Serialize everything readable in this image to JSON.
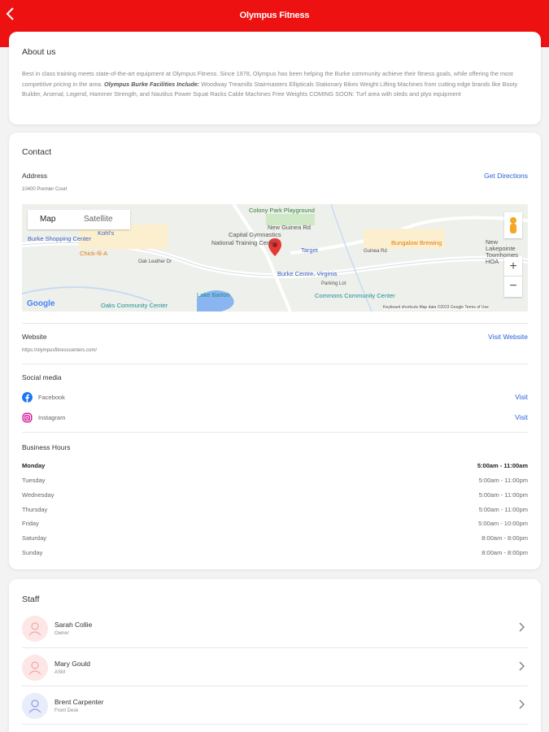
{
  "header": {
    "title": "Olympus Fitness",
    "back_icon": "chevron-left-icon",
    "color": "#ee1111"
  },
  "about": {
    "heading": "About us",
    "text_1": "Best in class training meets state-of-the-art equipment at Olympus Fitness. Since 1978, Olympus has been helping the Burke community achieve their fitness goals, while offering the most competitive pricing in the area.  ",
    "text_bold": "Olympus Burke Facilities Include:",
    "text_2": " Woodway Treamills  Stairmasters Ellipticals Stationary Bikes  Weight Lifting Machines from cutting edge brands like Booty Builder, Arsenal, Legend, Hammer Strength, and Nautilus Power Squat Racks Cable Machines  Free Weights  COMING SOON: Turf area with sleds and plyo equipment"
  },
  "contact": {
    "heading": "Contact",
    "address_label": "Address",
    "address_value": "10400 Premier Court",
    "directions_link": "Get Directions",
    "map": {
      "toggle_map": "Map",
      "toggle_satellite": "Satellite",
      "labels": [
        "Colony Park Playground",
        "New Guinea Rd",
        "Capital Gymnastics",
        "National Training Center",
        "Target",
        "Burke Centre, Virginia",
        "Parking Lot",
        "Commons Community Center",
        "Lake Barton",
        "Oaks Community Center",
        "Chick-fil-A",
        "Kohl's",
        "Burke Shopping Center",
        "Bungalow Brewing",
        "New Lakepointe Townhomes HOA",
        "Guinea Rd",
        "Oak Leather Dr"
      ],
      "google": "Google",
      "footer": "Keyboard shortcuts   Map data ©2023 Google   Terms of Use"
    },
    "website_label": "Website",
    "website_value": "https://olympusfitnesscenters.com/",
    "website_link": "Visit Website",
    "social_label": "Social media",
    "social": [
      {
        "name": "Facebook",
        "action": "Visit",
        "icon": "facebook-icon"
      },
      {
        "name": "Instagram",
        "action": "Visit",
        "icon": "instagram-icon"
      }
    ],
    "hours_label": "Business Hours",
    "hours": [
      {
        "day": "Monday",
        "time": "5:00am - 11:00am"
      },
      {
        "day": "Tuesday",
        "time": "5:00am - 11:00pm"
      },
      {
        "day": "Wednesday",
        "time": "5:00am - 11:00pm"
      },
      {
        "day": "Thursday",
        "time": "5:00am - 11:00pm"
      },
      {
        "day": "Friday",
        "time": "5:00am - 10:00pm"
      },
      {
        "day": "Saturday",
        "time": "8:00am - 8:00pm"
      },
      {
        "day": "Sunday",
        "time": "8:00am - 8:00pm"
      }
    ]
  },
  "staff": {
    "heading": "Staff",
    "members": [
      {
        "name": "Sarah Collie",
        "role": "Owner"
      },
      {
        "name": "Mary Gould",
        "role": "ASM"
      },
      {
        "name": "Brent Carpenter",
        "role": "Front Desk"
      }
    ]
  }
}
